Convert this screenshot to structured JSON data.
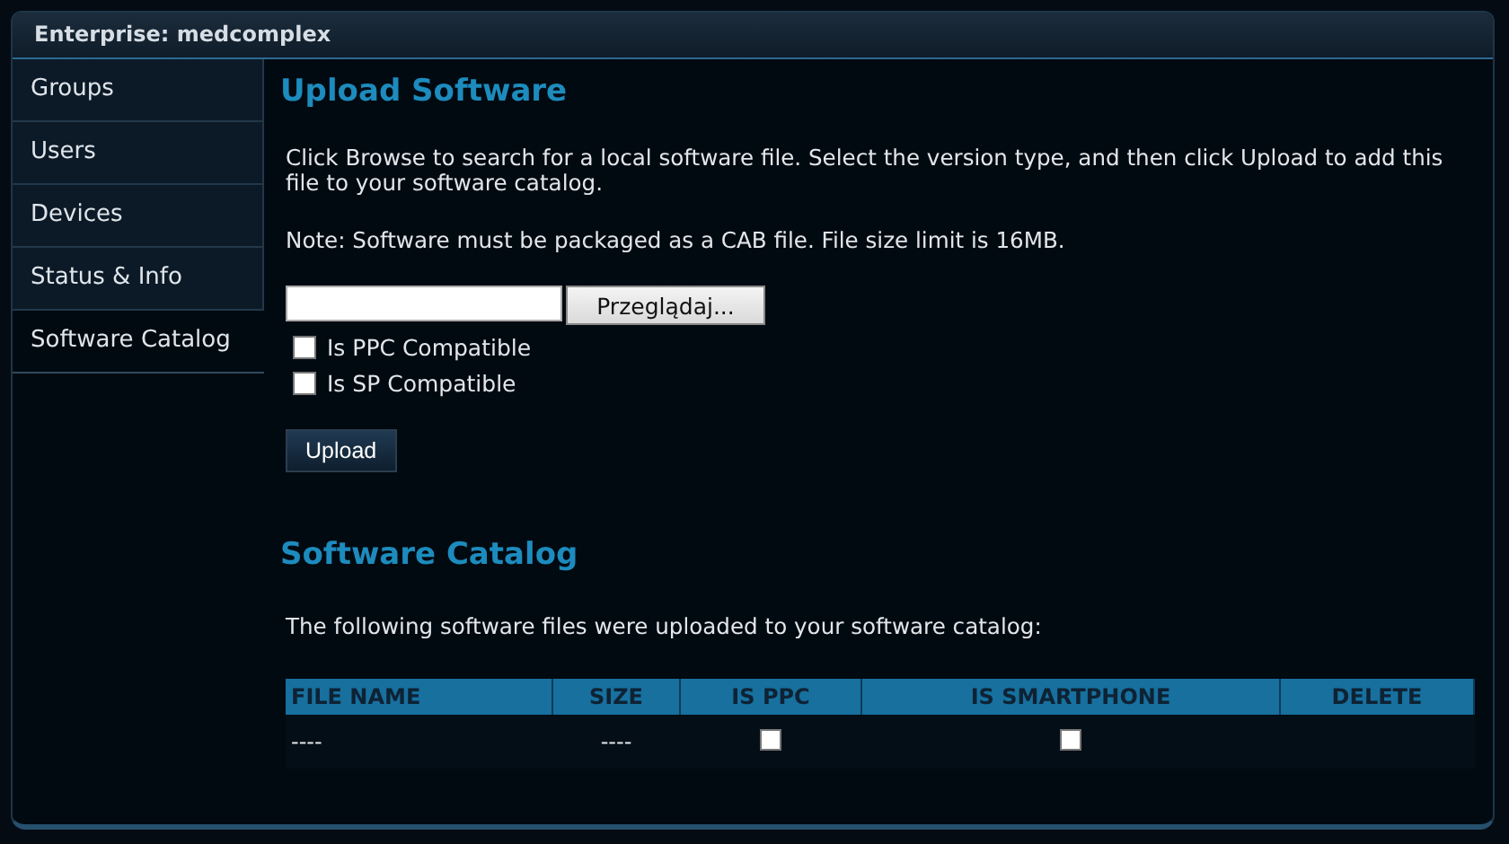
{
  "window": {
    "title": "Enterprise: medcomplex"
  },
  "sidebar": {
    "items": [
      {
        "label": "Groups",
        "selected": false
      },
      {
        "label": "Users",
        "selected": false
      },
      {
        "label": "Devices",
        "selected": false
      },
      {
        "label": "Status & Info",
        "selected": false
      },
      {
        "label": "Software Catalog",
        "selected": true
      }
    ]
  },
  "upload": {
    "heading": "Upload Software",
    "instructions": "Click Browse to search for a local software file. Select the version type, and then click Upload to add this file to your software catalog.",
    "note": "Note: Software must be packaged as a CAB file. File size limit is 16MB.",
    "browse_button": "Przeglądaj...",
    "checkboxes": [
      {
        "label": "Is PPC Compatible",
        "checked": false
      },
      {
        "label": "Is SP Compatible",
        "checked": false
      }
    ],
    "upload_button": "Upload"
  },
  "catalog": {
    "heading": "Software Catalog",
    "intro": "The following software files were uploaded to your software catalog:",
    "table": {
      "columns": [
        "FILE NAME",
        "SIZE",
        "IS PPC",
        "IS SMARTPHONE",
        "DELETE"
      ],
      "rows": [
        {
          "file_name": "----",
          "size": "----",
          "is_ppc": false,
          "is_smartphone": false
        }
      ]
    }
  }
}
